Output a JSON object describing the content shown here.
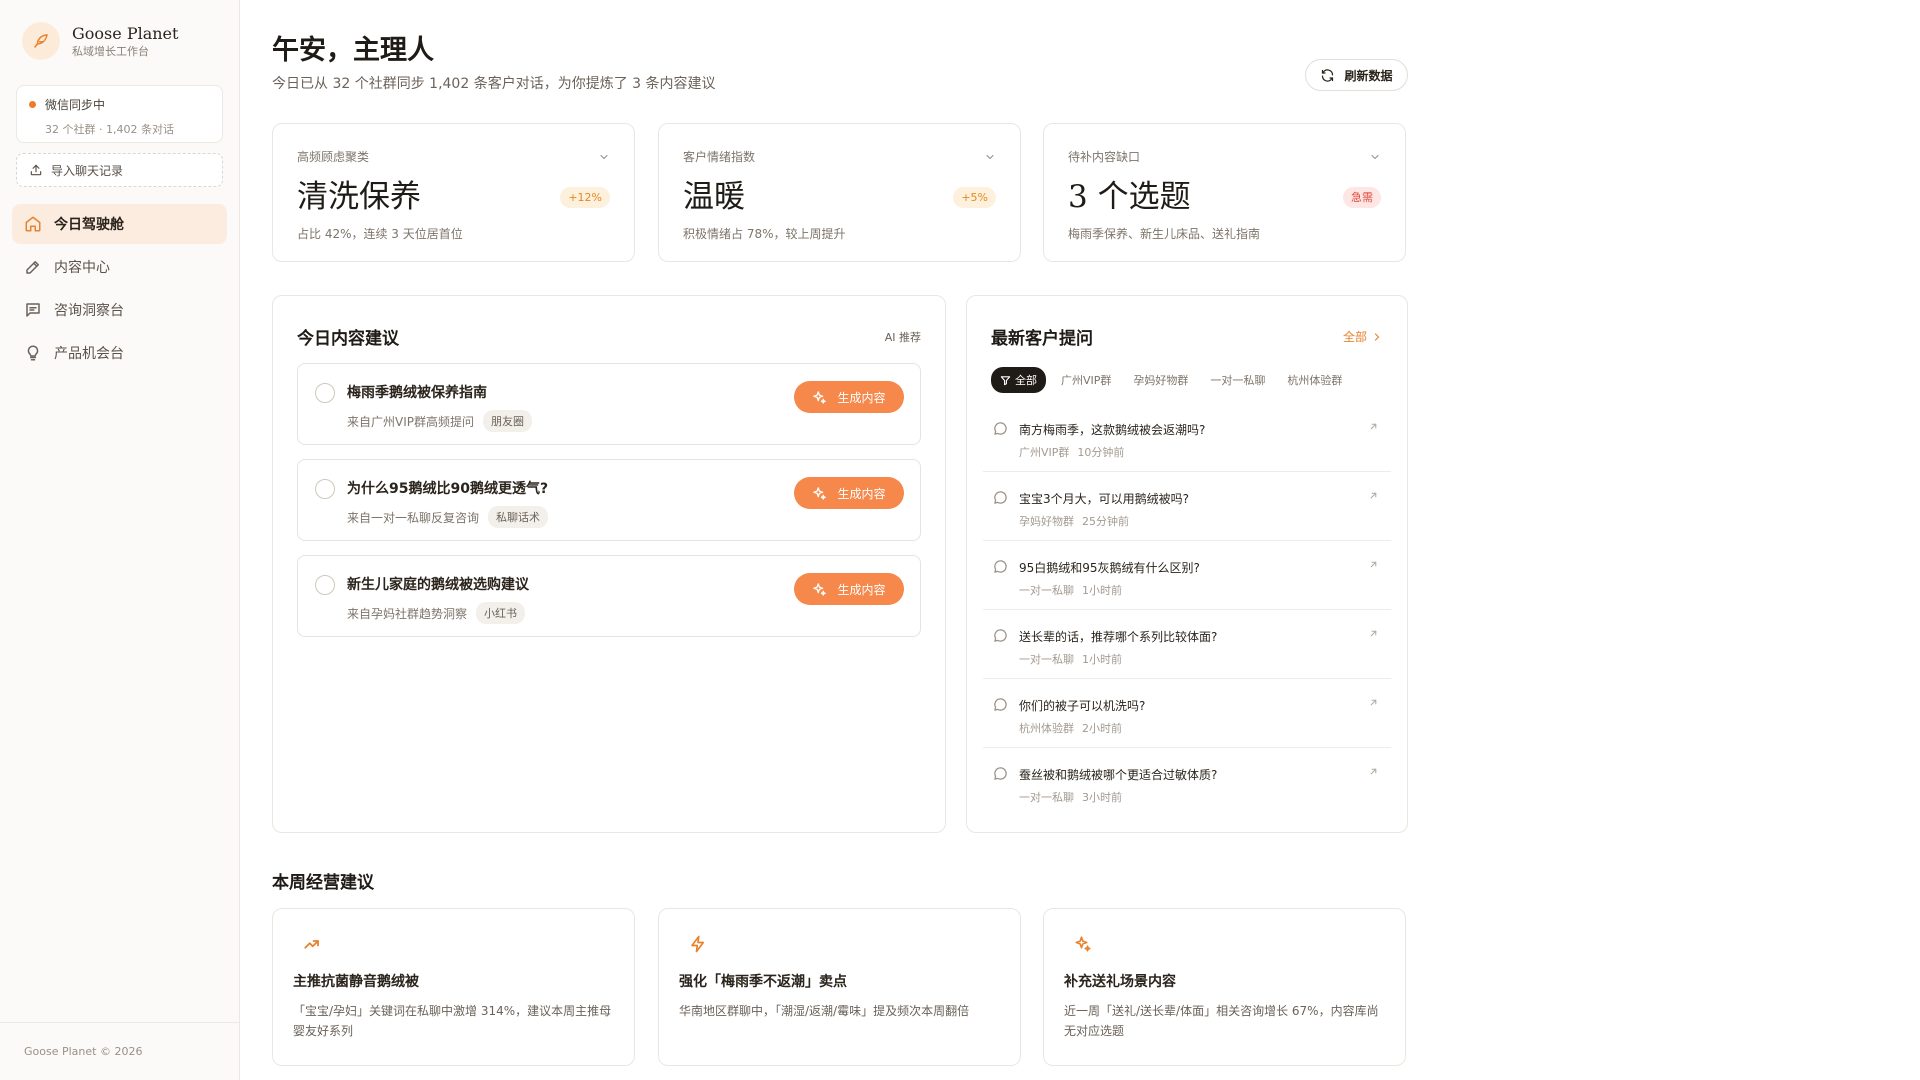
{
  "sidebar": {
    "brand_name": "Goose Planet",
    "brand_sub": "私域增长工作台",
    "sync_title": "微信同步中",
    "sync_meta": "32 个社群 · 1,402 条对话",
    "import_label": "导入聊天记录",
    "nav": [
      {
        "label": "今日驾驶舱",
        "icon": "home-icon",
        "active": true
      },
      {
        "label": "内容中心",
        "icon": "pen-icon"
      },
      {
        "label": "咨询洞察台",
        "icon": "message-icon"
      },
      {
        "label": "产品机会台",
        "icon": "lightbulb-icon"
      }
    ],
    "footer": "Goose Planet © 2026"
  },
  "header": {
    "title": "午安，主理人",
    "subtitle": "今日已从 32 个社群同步 1,402 条客户对话，为你提炼了 3 条内容建议",
    "refresh_label": "刷新数据"
  },
  "metrics": [
    {
      "label": "高频顾虑聚类",
      "value": "清洗保养",
      "badge": "+12%",
      "badge_color": "#e6891e",
      "desc": "占比 42%，连续 3 天位居首位"
    },
    {
      "label": "客户情绪指数",
      "value": "温暖",
      "badge": "+5%",
      "badge_color": "#e6891e",
      "desc": "积极情绪占 78%，较上周提升"
    },
    {
      "label": "待补内容缺口",
      "value": "3 个选题",
      "badge": "急需",
      "badge_color": "#e04a3c",
      "desc": "梅雨季保养、新生儿床品、送礼指南"
    }
  ],
  "suggestions": {
    "title": "今日内容建议",
    "ai_label": "AI 推荐",
    "button_label": "生成内容",
    "items": [
      {
        "title": "梅雨季鹅绒被保养指南",
        "source": "来自广州VIP群高频提问",
        "tag": "朋友圈"
      },
      {
        "title": "为什么95鹅绒比90鹅绒更透气?",
        "source": "来自一对一私聊反复咨询",
        "tag": "私聊话术"
      },
      {
        "title": "新生儿家庭的鹅绒被选购建议",
        "source": "来自孕妈社群趋势洞察",
        "tag": "小红书"
      }
    ]
  },
  "questions": {
    "title": "最新客户提问",
    "all_label": "全部",
    "filters": [
      "全部",
      "广州VIP群",
      "孕妈好物群",
      "一对一私聊",
      "杭州体验群"
    ],
    "items": [
      {
        "text": "南方梅雨季，这款鹅绒被会返潮吗?",
        "group": "广州VIP群",
        "time": "10分钟前"
      },
      {
        "text": "宝宝3个月大，可以用鹅绒被吗?",
        "group": "孕妈好物群",
        "time": "25分钟前"
      },
      {
        "text": "95白鹅绒和95灰鹅绒有什么区别?",
        "group": "一对一私聊",
        "time": "1小时前"
      },
      {
        "text": "送长辈的话，推荐哪个系列比较体面?",
        "group": "一对一私聊",
        "time": "1小时前"
      },
      {
        "text": "你们的被子可以机洗吗?",
        "group": "杭州体验群",
        "time": "2小时前"
      },
      {
        "text": "蚕丝被和鹅绒被哪个更适合过敏体质?",
        "group": "一对一私聊",
        "time": "3小时前"
      }
    ]
  },
  "weekly": {
    "title": "本周经营建议",
    "items": [
      {
        "icon": "trending-up-icon",
        "title": "主推抗菌静音鹅绒被",
        "desc": "「宝宝/孕妇」关键词在私聊中激增 314%，建议本周主推母婴友好系列"
      },
      {
        "icon": "lightning-icon",
        "title": "强化「梅雨季不返潮」卖点",
        "desc": "华南地区群聊中，「潮湿/返潮/霉味」提及频次本周翻倍"
      },
      {
        "icon": "sparkle-icon",
        "title": "补充送礼场景内容",
        "desc": "近一周「送礼/送长辈/体面」相关咨询增长 67%，内容库尚无对应选题"
      }
    ]
  },
  "colors": {
    "accent": "#f5884a",
    "accent_text": "#e8822c",
    "active_nav_bg": "#fcece0"
  }
}
